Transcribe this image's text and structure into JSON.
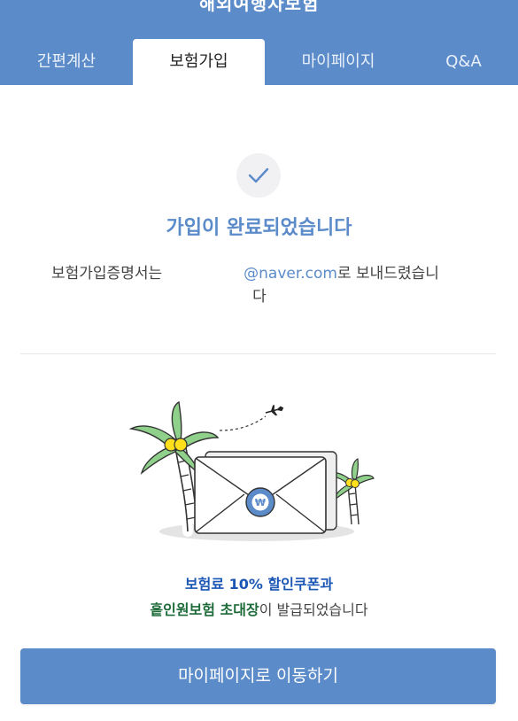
{
  "header": {
    "title": "해외여행자보험",
    "tabs": [
      {
        "label": "간편계산"
      },
      {
        "label": "보험가입"
      },
      {
        "label": "마이페이지"
      },
      {
        "label": "Q&A"
      }
    ],
    "active_tab": "보험가입"
  },
  "completion": {
    "icon": "check-icon",
    "title": "가입이 완료되었습니다",
    "cert_prefix": "보험가입증명서는",
    "email_domain": "@naver.com",
    "cert_suffix": "로 보내드렸습니",
    "cert_suffix_line2": "다"
  },
  "illustration": {
    "icons": [
      "palm-tree-icon",
      "airplane-icon",
      "envelope-icon",
      "won-coupon-icon"
    ]
  },
  "coupon": {
    "line1": "보험료 10% 할인쿠폰과",
    "line2_highlight": "흩인원보험 초대장",
    "line2_rest": "이 발급되었습니다"
  },
  "cta": {
    "label": "마이페이지로 이동하기"
  },
  "colors": {
    "brand": "#5b8bc9",
    "coupon_blue": "#1c56b5",
    "coupon_green": "#1e6b3a"
  }
}
